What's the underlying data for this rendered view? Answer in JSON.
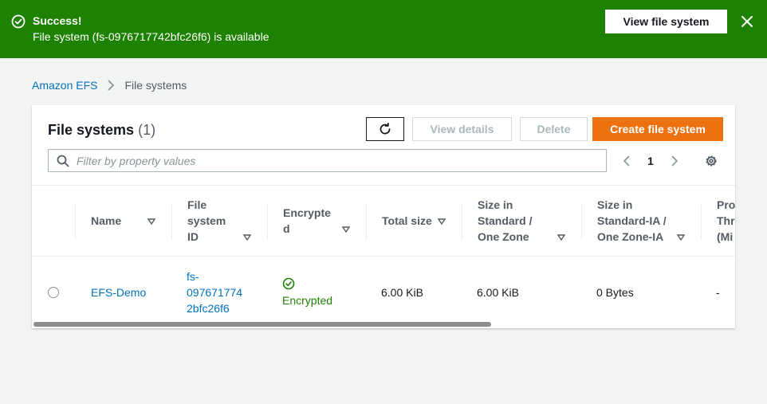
{
  "flash": {
    "title": "Success!",
    "message": "File system (fs-0976717742bfc26f6) is available",
    "action_label": "View file system",
    "icons": {
      "status": "check-circle-icon",
      "dismiss": "close-icon"
    }
  },
  "breadcrumb": {
    "root": "Amazon EFS",
    "current": "File systems"
  },
  "panel": {
    "title": "File systems",
    "count": "(1)",
    "buttons": {
      "view_details": "View details",
      "delete": "Delete",
      "create": "Create file system"
    },
    "filter_placeholder": "Filter by property values",
    "page": "1"
  },
  "table": {
    "columns": [
      {
        "label_lines": [
          "Name"
        ]
      },
      {
        "label_lines": [
          "File",
          "system",
          "ID"
        ]
      },
      {
        "label_lines": [
          "Encrypte",
          "d"
        ]
      },
      {
        "label_lines": [
          "Total size"
        ]
      },
      {
        "label_lines": [
          "Size in",
          "Standard /",
          "One Zone"
        ]
      },
      {
        "label_lines": [
          "Size in",
          "Standard-IA /",
          "One Zone-IA"
        ]
      },
      {
        "label_lines": [
          "Pro",
          "Thr",
          "(Mi"
        ]
      }
    ],
    "rows": [
      {
        "name": "EFS-Demo",
        "id_lines": [
          "fs-",
          "097671774",
          "2bfc26f6"
        ],
        "encrypted": "Encrypted",
        "total_size": "6.00 KiB",
        "size_standard": "6.00 KiB",
        "size_ia": "0 Bytes",
        "throughput": "-"
      }
    ]
  },
  "colors": {
    "success": "#1d8102",
    "link": "#0073bb",
    "primary": "#ec7211"
  }
}
